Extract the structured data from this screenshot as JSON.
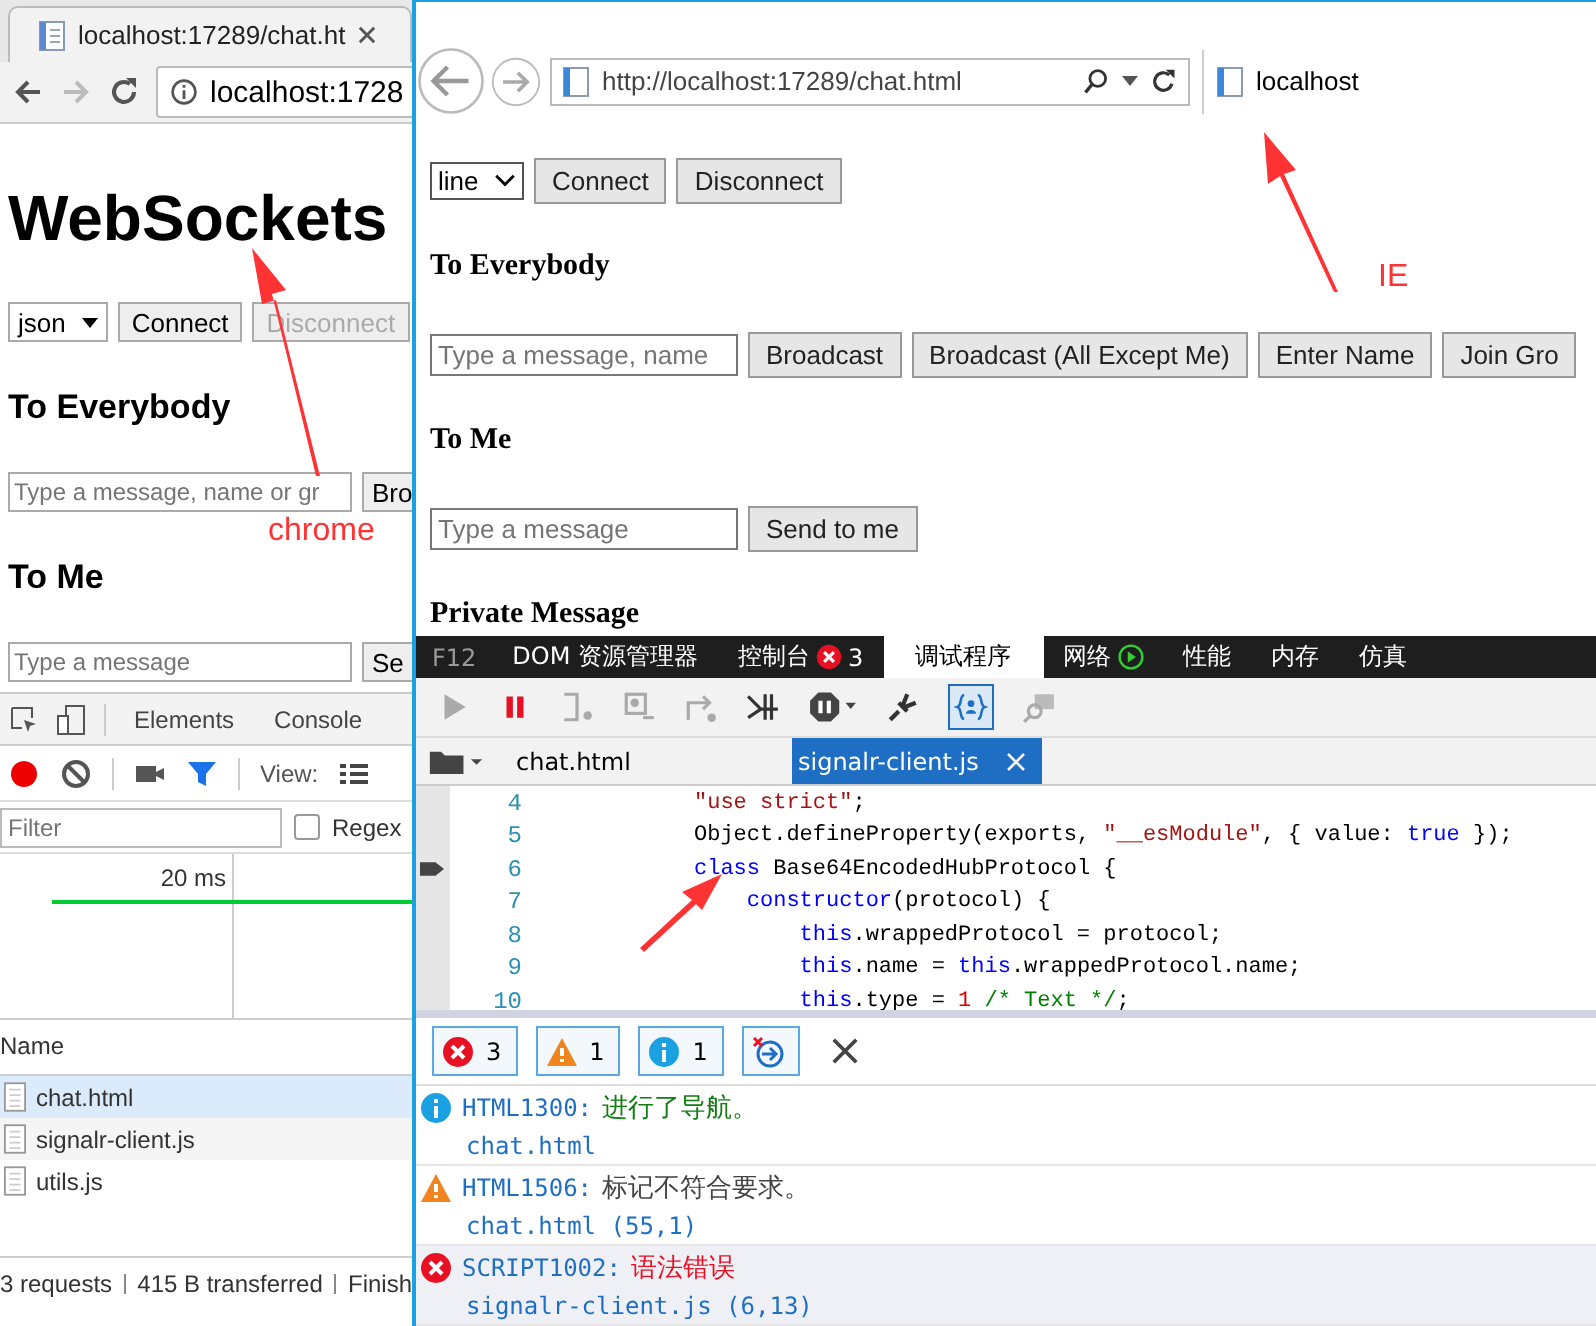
{
  "chrome": {
    "tab_title": "localhost:17289/chat.ht",
    "address": "localhost:1728",
    "page": {
      "heading": "WebSockets",
      "protocol_select": "json",
      "buttons": [
        {
          "label": "Connect",
          "disabled": false
        },
        {
          "label": "Disconnect",
          "disabled": true
        }
      ],
      "sections": [
        {
          "title": "To Everybody",
          "input_placeholder": "Type a message, name or gr",
          "buttons": [
            "Bro"
          ]
        },
        {
          "title": "To Me",
          "input_placeholder": "Type a message",
          "buttons": [
            "Se"
          ]
        }
      ]
    },
    "devtools": {
      "tabs": [
        {
          "label": "Elements",
          "selected": false
        },
        {
          "label": "Console",
          "selected": false
        }
      ],
      "view_label": "View:",
      "filter_placeholder": "Filter",
      "regex": {
        "label": "Regex",
        "checked": false
      },
      "timeline_tick": "20 ms",
      "name_header": "Name",
      "requests": [
        {
          "name": "chat.html",
          "selected": true
        },
        {
          "name": "signalr-client.js",
          "selected": false
        },
        {
          "name": "utils.js",
          "selected": false
        }
      ],
      "status": [
        "3 requests",
        "415 B transferred",
        "Finish"
      ]
    }
  },
  "ie": {
    "address": "http://localhost:17289/chat.html",
    "tab_title": "localhost",
    "page": {
      "protocol_select": "line",
      "buttons": [
        {
          "label": "Connect",
          "disabled": false
        },
        {
          "label": "Disconnect",
          "disabled": false
        }
      ],
      "sections": [
        {
          "title": "To Everybody",
          "input_placeholder": "Type a message, name",
          "buttons": [
            "Broadcast",
            "Broadcast (All Except Me)",
            "Enter Name",
            "Join Gro"
          ]
        },
        {
          "title": "To Me",
          "input_placeholder": "Type a message",
          "buttons": [
            "Send to me"
          ]
        },
        {
          "title": "Private Message"
        }
      ]
    },
    "f12": {
      "label": "F12",
      "tabs": [
        {
          "label": "DOM 资源管理器",
          "kind": "plain",
          "selected": false
        },
        {
          "label": "控制台",
          "kind": "errors",
          "badge": "3",
          "selected": false
        },
        {
          "label": "调试程序",
          "kind": "plain",
          "selected": true
        },
        {
          "label": "网络",
          "kind": "network",
          "selected": false
        },
        {
          "label": "性能",
          "kind": "plain",
          "selected": false
        },
        {
          "label": "内存",
          "kind": "plain",
          "selected": false
        },
        {
          "label": "仿真",
          "kind": "plain",
          "selected": false
        }
      ],
      "pretty_print": true,
      "file_tabs": [
        {
          "label": "chat.html",
          "selected": false
        },
        {
          "label": "signalr-client.js",
          "selected": true
        }
      ],
      "code_lines": [
        {
          "number": "4",
          "current": false,
          "tokens": [
            {
              "kind": "string",
              "text": "\"use strict\""
            },
            {
              "kind": "plain",
              "text": ";"
            }
          ]
        },
        {
          "number": "5",
          "current": false,
          "tokens": [
            {
              "kind": "plain",
              "text": "Object.defineProperty(exports, "
            },
            {
              "kind": "string",
              "text": "\"__esModule\""
            },
            {
              "kind": "plain",
              "text": ", { value: "
            },
            {
              "kind": "keyword",
              "text": "true"
            },
            {
              "kind": "plain",
              "text": " });"
            }
          ]
        },
        {
          "number": "6",
          "current": true,
          "tokens": [
            {
              "kind": "keyword",
              "text": "class"
            },
            {
              "kind": "plain",
              "text": " Base64EncodedHubProtocol {"
            }
          ]
        },
        {
          "number": "7",
          "current": false,
          "tokens": [
            {
              "kind": "keyword",
              "text": "    constructor"
            },
            {
              "kind": "plain",
              "text": "(protocol) {"
            }
          ]
        },
        {
          "number": "8",
          "current": false,
          "tokens": [
            {
              "kind": "keyword",
              "text": "        this"
            },
            {
              "kind": "plain",
              "text": ".wrappedProtocol = protocol;"
            }
          ]
        },
        {
          "number": "9",
          "current": false,
          "tokens": [
            {
              "kind": "keyword",
              "text": "        this"
            },
            {
              "kind": "plain",
              "text": ".name = "
            },
            {
              "kind": "keyword",
              "text": "this"
            },
            {
              "kind": "plain",
              "text": ".wrappedProtocol.name;"
            }
          ]
        },
        {
          "number": "10",
          "current": false,
          "tokens": [
            {
              "kind": "keyword",
              "text": "        this"
            },
            {
              "kind": "plain",
              "text": ".type = "
            },
            {
              "kind": "number",
              "text": "1"
            },
            {
              "kind": "comment",
              "text": " /* Text */"
            },
            {
              "kind": "plain",
              "text": ";"
            }
          ]
        }
      ],
      "console": {
        "filters": [
          {
            "kind": "error",
            "count": "3"
          },
          {
            "kind": "warning",
            "count": "1"
          },
          {
            "kind": "info",
            "count": "1"
          }
        ],
        "messages": [
          {
            "kind": "info",
            "code": "HTML1300:",
            "text": "进行了导航。",
            "source": "chat.html"
          },
          {
            "kind": "warning",
            "code": "HTML1506:",
            "text": "标记不符合要求。",
            "source": "chat.html (55,1)"
          },
          {
            "kind": "error",
            "code": "SCRIPT1002:",
            "text": "语法错误",
            "source": "signalr-client.js (6,13)"
          }
        ]
      }
    }
  },
  "annotations": [
    {
      "text": "chrome"
    },
    {
      "text": "IE"
    }
  ]
}
